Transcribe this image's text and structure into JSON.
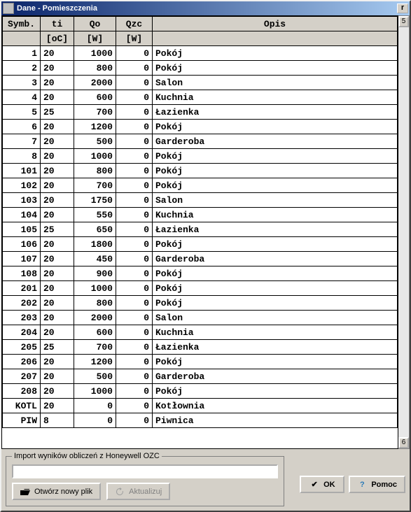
{
  "window": {
    "title": "Dane - Pomieszczenia"
  },
  "headers": {
    "symb": "Symb.",
    "ti": "ti",
    "qo": "Qo",
    "qzc": "Qzc",
    "opis": "Opis"
  },
  "units": {
    "symb": "",
    "ti": "[oC]",
    "qo": "[W]",
    "qzc": "[W]",
    "opis": ""
  },
  "rows": [
    {
      "symb": "1",
      "ti": "20",
      "qo": "1000",
      "qzc": "0",
      "opis": "Pokój"
    },
    {
      "symb": "2",
      "ti": "20",
      "qo": "800",
      "qzc": "0",
      "opis": "Pokój"
    },
    {
      "symb": "3",
      "ti": "20",
      "qo": "2000",
      "qzc": "0",
      "opis": "Salon"
    },
    {
      "symb": "4",
      "ti": "20",
      "qo": "600",
      "qzc": "0",
      "opis": "Kuchnia"
    },
    {
      "symb": "5",
      "ti": "25",
      "qo": "700",
      "qzc": "0",
      "opis": "Łazienka"
    },
    {
      "symb": "6",
      "ti": "20",
      "qo": "1200",
      "qzc": "0",
      "opis": "Pokój"
    },
    {
      "symb": "7",
      "ti": "20",
      "qo": "500",
      "qzc": "0",
      "opis": "Garderoba"
    },
    {
      "symb": "8",
      "ti": "20",
      "qo": "1000",
      "qzc": "0",
      "opis": "Pokój"
    },
    {
      "symb": "101",
      "ti": "20",
      "qo": "800",
      "qzc": "0",
      "opis": "Pokój"
    },
    {
      "symb": "102",
      "ti": "20",
      "qo": "700",
      "qzc": "0",
      "opis": "Pokój"
    },
    {
      "symb": "103",
      "ti": "20",
      "qo": "1750",
      "qzc": "0",
      "opis": "Salon"
    },
    {
      "symb": "104",
      "ti": "20",
      "qo": "550",
      "qzc": "0",
      "opis": "Kuchnia"
    },
    {
      "symb": "105",
      "ti": "25",
      "qo": "650",
      "qzc": "0",
      "opis": "Łazienka"
    },
    {
      "symb": "106",
      "ti": "20",
      "qo": "1800",
      "qzc": "0",
      "opis": "Pokój"
    },
    {
      "symb": "107",
      "ti": "20",
      "qo": "450",
      "qzc": "0",
      "opis": "Garderoba"
    },
    {
      "symb": "108",
      "ti": "20",
      "qo": "900",
      "qzc": "0",
      "opis": "Pokój"
    },
    {
      "symb": "201",
      "ti": "20",
      "qo": "1000",
      "qzc": "0",
      "opis": "Pokój"
    },
    {
      "symb": "202",
      "ti": "20",
      "qo": "800",
      "qzc": "0",
      "opis": "Pokój"
    },
    {
      "symb": "203",
      "ti": "20",
      "qo": "2000",
      "qzc": "0",
      "opis": "Salon"
    },
    {
      "symb": "204",
      "ti": "20",
      "qo": "600",
      "qzc": "0",
      "opis": "Kuchnia"
    },
    {
      "symb": "205",
      "ti": "25",
      "qo": "700",
      "qzc": "0",
      "opis": "Łazienka"
    },
    {
      "symb": "206",
      "ti": "20",
      "qo": "1200",
      "qzc": "0",
      "opis": "Pokój"
    },
    {
      "symb": "207",
      "ti": "20",
      "qo": "500",
      "qzc": "0",
      "opis": "Garderoba"
    },
    {
      "symb": "208",
      "ti": "20",
      "qo": "1000",
      "qzc": "0",
      "opis": "Pokój"
    },
    {
      "symb": "KOTL",
      "ti": "20",
      "qo": "0",
      "qzc": "0",
      "opis": "Kotłownia"
    },
    {
      "symb": "PIW",
      "ti": "8",
      "qo": "0",
      "qzc": "0",
      "opis": "Piwnica"
    }
  ],
  "import": {
    "legend": "Import wyników obliczeń z Honeywell OZC",
    "path": "",
    "open_label": "Otwórz nowy plik",
    "update_label": "Aktualizuj"
  },
  "buttons": {
    "ok": "OK",
    "help": "Pomoc"
  }
}
